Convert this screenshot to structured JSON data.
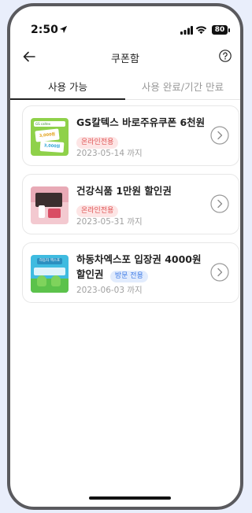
{
  "status": {
    "time": "2:50",
    "battery": "80"
  },
  "header": {
    "title": "쿠폰함"
  },
  "tabs": [
    {
      "label": "사용 가능"
    },
    {
      "label": "사용 완료/기간 만료"
    }
  ],
  "coupons": [
    {
      "name": "GS칼텍스 바로주유쿠폰 6천원",
      "badge": "온라인전용",
      "date": "2023-05-14 까지"
    },
    {
      "name": "건강식품 1만원 할인권",
      "badge": "온라인전용",
      "date": "2023-05-31 까지"
    },
    {
      "name_line1": "하동차엑스포 입장권 4000원",
      "name_line2": "할인권",
      "badge": "방문 전용",
      "date": "2023-06-03 까지"
    }
  ],
  "thumb_texts": {
    "gs_logo": "GS caltex",
    "gs_amount1": "3,000원",
    "gs_amount2": "3,000원",
    "expo_title": "하동차 엑스포"
  }
}
